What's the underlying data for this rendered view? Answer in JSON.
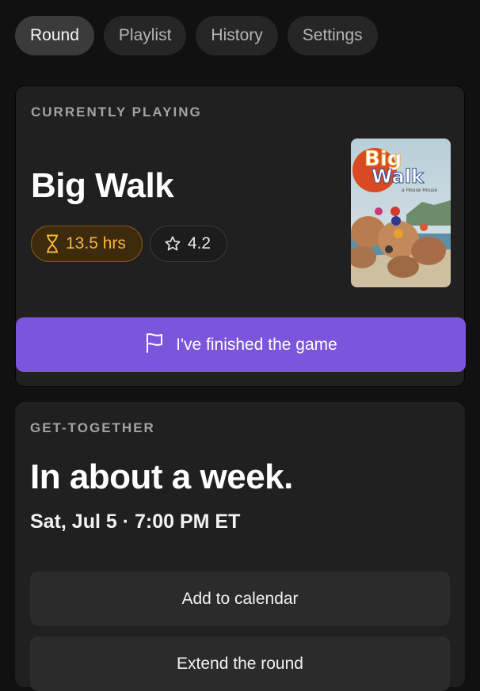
{
  "tabs": [
    {
      "label": "Round",
      "active": true
    },
    {
      "label": "Playlist",
      "active": false
    },
    {
      "label": "History",
      "active": false
    },
    {
      "label": "Settings",
      "active": false
    }
  ],
  "now_playing": {
    "section_label": "CURRENTLY PLAYING",
    "title": "Big Walk",
    "hours": "13.5 hrs",
    "hours_icon": "hourglass-icon",
    "rating": "4.2",
    "rating_icon": "star-icon",
    "cover_title_line1": "Big",
    "cover_title_line2": "Walk",
    "cover_credit": "a House House",
    "finish_label": "I've finished the game",
    "finish_icon": "flag-icon",
    "colors": {
      "accent": "#7b55db",
      "hours_chip_text": "#f5b73b",
      "hours_chip_bg": "#3e2a0c"
    }
  },
  "get_together": {
    "section_label": "GET-TOGETHER",
    "headline": "In about a week.",
    "datetime": "Sat, Jul 5 · 7:00 PM ET",
    "add_calendar_label": "Add to calendar",
    "extend_label": "Extend the round"
  }
}
